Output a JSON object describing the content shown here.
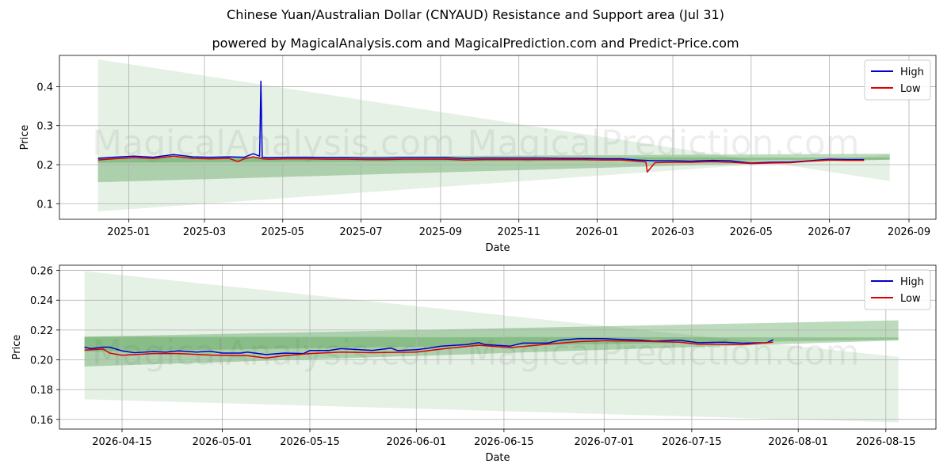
{
  "title": "Chinese Yuan/Australian Dollar (CNYAUD) Resistance and Support area (Jul 31)",
  "subtitle": "powered by MagicalAnalysis.com and MagicalPrediction.com and Predict-Price.com",
  "watermarks": [
    "MagicalAnalysis.com",
    "MagicalPrediction.com"
  ],
  "colors": {
    "high": "#0000cc",
    "low": "#dd0000",
    "band": "#2e8b2e",
    "grid": "#b0b0b0"
  },
  "chart_data": [
    {
      "type": "line",
      "xlabel": "Date",
      "ylabel": "Price",
      "x_ticks": [
        "2025-01",
        "2025-03",
        "2025-05",
        "2025-07",
        "2025-09",
        "2025-11",
        "2026-01",
        "2026-03",
        "2026-05",
        "2026-07",
        "2026-09"
      ],
      "y_ticks": [
        "0.1",
        "0.2",
        "0.3",
        "0.4"
      ],
      "xlim": [
        "2024-11-08",
        "2026-09-22"
      ],
      "ylim": [
        0.06,
        0.48
      ],
      "grid": true,
      "legend": "top-right",
      "legend_entries": [
        "High",
        "Low"
      ],
      "bands": [
        {
          "x": [
            "2024-12-08",
            "2026-08-17"
          ],
          "upper": [
            0.47,
            0.158
          ],
          "lower": [
            0.08,
            0.225
          ],
          "opacity": 0.12
        },
        {
          "x": [
            "2024-12-08",
            "2026-08-17"
          ],
          "upper": [
            0.218,
            0.228
          ],
          "lower": [
            0.155,
            0.213
          ],
          "opacity": 0.32
        },
        {
          "x": [
            "2024-12-08",
            "2026-08-17"
          ],
          "upper": [
            0.22,
            0.218
          ],
          "lower": [
            0.205,
            0.213
          ],
          "opacity": 0.28
        }
      ],
      "series": [
        {
          "name": "High",
          "x": [
            "2024-12-08",
            "2024-12-20",
            "2025-01-05",
            "2025-01-20",
            "2025-02-05",
            "2025-02-20",
            "2025-03-05",
            "2025-03-20",
            "2025-04-01",
            "2025-04-08",
            "2025-04-13",
            "2025-04-14",
            "2025-04-15",
            "2025-04-20",
            "2025-05-05",
            "2025-05-20",
            "2025-06-05",
            "2025-06-20",
            "2025-07-05",
            "2025-07-20",
            "2025-08-05",
            "2025-08-20",
            "2025-09-05",
            "2025-09-20",
            "2025-10-05",
            "2025-10-20",
            "2025-11-05",
            "2025-11-20",
            "2025-12-05",
            "2025-12-20",
            "2026-01-05",
            "2026-01-20",
            "2026-02-01",
            "2026-02-08",
            "2026-02-15",
            "2026-03-01",
            "2026-03-15",
            "2026-04-01",
            "2026-04-15",
            "2026-05-01",
            "2026-05-15",
            "2026-06-01",
            "2026-06-15",
            "2026-07-01",
            "2026-07-15",
            "2026-07-28"
          ],
          "y": [
            0.216,
            0.219,
            0.222,
            0.219,
            0.226,
            0.22,
            0.219,
            0.22,
            0.219,
            0.228,
            0.222,
            0.414,
            0.219,
            0.218,
            0.219,
            0.219,
            0.218,
            0.218,
            0.217,
            0.217,
            0.218,
            0.218,
            0.218,
            0.216,
            0.217,
            0.217,
            0.217,
            0.217,
            0.216,
            0.216,
            0.215,
            0.215,
            0.212,
            0.211,
            0.21,
            0.21,
            0.209,
            0.211,
            0.21,
            0.204,
            0.206,
            0.207,
            0.21,
            0.214,
            0.213,
            0.213
          ]
        },
        {
          "name": "Low",
          "x": [
            "2024-12-08",
            "2024-12-20",
            "2025-01-05",
            "2025-01-20",
            "2025-02-05",
            "2025-02-20",
            "2025-03-05",
            "2025-03-20",
            "2025-03-27",
            "2025-04-01",
            "2025-04-08",
            "2025-04-15",
            "2025-04-20",
            "2025-05-05",
            "2025-05-20",
            "2025-06-05",
            "2025-06-20",
            "2025-07-05",
            "2025-07-20",
            "2025-08-05",
            "2025-08-20",
            "2025-09-05",
            "2025-09-20",
            "2025-10-05",
            "2025-10-20",
            "2025-11-05",
            "2025-11-20",
            "2025-12-05",
            "2025-12-20",
            "2026-01-05",
            "2026-01-20",
            "2026-02-01",
            "2026-02-08",
            "2026-02-09",
            "2026-02-15",
            "2026-03-01",
            "2026-03-15",
            "2026-04-01",
            "2026-04-15",
            "2026-05-01",
            "2026-05-15",
            "2026-06-01",
            "2026-06-15",
            "2026-07-01",
            "2026-07-15",
            "2026-07-28"
          ],
          "y": [
            0.212,
            0.215,
            0.218,
            0.216,
            0.222,
            0.216,
            0.215,
            0.216,
            0.208,
            0.215,
            0.22,
            0.215,
            0.214,
            0.215,
            0.215,
            0.214,
            0.214,
            0.213,
            0.213,
            0.214,
            0.214,
            0.214,
            0.212,
            0.213,
            0.213,
            0.213,
            0.213,
            0.213,
            0.213,
            0.212,
            0.212,
            0.209,
            0.207,
            0.181,
            0.205,
            0.206,
            0.206,
            0.208,
            0.206,
            0.203,
            0.204,
            0.205,
            0.209,
            0.212,
            0.211,
            0.211
          ]
        }
      ]
    },
    {
      "type": "line",
      "xlabel": "Date",
      "ylabel": "Price",
      "x_ticks": [
        "2026-04-15",
        "2026-05-01",
        "2026-05-15",
        "2026-06-01",
        "2026-06-15",
        "2026-07-01",
        "2026-07-15",
        "2026-08-01",
        "2026-08-15"
      ],
      "y_ticks": [
        "0.16",
        "0.18",
        "0.20",
        "0.22",
        "0.24",
        "0.26"
      ],
      "xlim": [
        "2026-04-05",
        "2026-08-23"
      ],
      "ylim": [
        0.1535,
        0.2635
      ],
      "grid": true,
      "legend": "top-right",
      "legend_entries": [
        "High",
        "Low"
      ],
      "bands": [
        {
          "x": [
            "2026-04-09",
            "2026-08-17"
          ],
          "upper": [
            0.2595,
            0.202
          ],
          "lower": [
            0.1735,
            0.158
          ],
          "opacity": 0.12
        },
        {
          "x": [
            "2026-04-09",
            "2026-08-17"
          ],
          "upper": [
            0.2155,
            0.2265
          ],
          "lower": [
            0.1955,
            0.213
          ],
          "opacity": 0.32
        },
        {
          "x": [
            "2026-04-09",
            "2026-08-17"
          ],
          "upper": [
            0.2155,
            0.215
          ],
          "lower": [
            0.2055,
            0.2135
          ],
          "opacity": 0.28
        }
      ],
      "series": [
        {
          "name": "High",
          "x": [
            "2026-04-09",
            "2026-04-10",
            "2026-04-12",
            "2026-04-13",
            "2026-04-15",
            "2026-04-17",
            "2026-04-20",
            "2026-04-22",
            "2026-04-24",
            "2026-04-27",
            "2026-04-29",
            "2026-05-01",
            "2026-05-04",
            "2026-05-05",
            "2026-05-08",
            "2026-05-11",
            "2026-05-14",
            "2026-05-15",
            "2026-05-18",
            "2026-05-20",
            "2026-05-25",
            "2026-05-28",
            "2026-05-29",
            "2026-06-01",
            "2026-06-03",
            "2026-06-05",
            "2026-06-09",
            "2026-06-11",
            "2026-06-12",
            "2026-06-16",
            "2026-06-18",
            "2026-06-22",
            "2026-06-24",
            "2026-06-27",
            "2026-07-01",
            "2026-07-03",
            "2026-07-07",
            "2026-07-09",
            "2026-07-13",
            "2026-07-16",
            "2026-07-20",
            "2026-07-23",
            "2026-07-27",
            "2026-07-28"
          ],
          "y": [
            0.2085,
            0.2075,
            0.2085,
            0.2085,
            0.206,
            0.2048,
            0.2055,
            0.2052,
            0.206,
            0.2052,
            0.2058,
            0.2045,
            0.2045,
            0.2052,
            0.2035,
            0.2045,
            0.2042,
            0.2062,
            0.2062,
            0.2075,
            0.2063,
            0.2078,
            0.2062,
            0.2068,
            0.2078,
            0.2092,
            0.2102,
            0.2115,
            0.2102,
            0.2092,
            0.2112,
            0.2112,
            0.2132,
            0.2142,
            0.2142,
            0.2138,
            0.2132,
            0.2125,
            0.2132,
            0.2115,
            0.2118,
            0.2112,
            0.2115,
            0.2135
          ]
        },
        {
          "name": "Low",
          "x": [
            "2026-04-09",
            "2026-04-12",
            "2026-04-13",
            "2026-04-15",
            "2026-04-20",
            "2026-04-24",
            "2026-04-29",
            "2026-05-05",
            "2026-05-08",
            "2026-05-11",
            "2026-05-15",
            "2026-05-20",
            "2026-05-25",
            "2026-06-01",
            "2026-06-05",
            "2026-06-09",
            "2026-06-11",
            "2026-06-16",
            "2026-06-22",
            "2026-06-27",
            "2026-07-01",
            "2026-07-07",
            "2026-07-13",
            "2026-07-16",
            "2026-07-23",
            "2026-07-28"
          ],
          "y": [
            0.2065,
            0.2072,
            0.2045,
            0.203,
            0.2042,
            0.2042,
            0.2032,
            0.2028,
            0.2012,
            0.2028,
            0.2042,
            0.2052,
            0.2048,
            0.2052,
            0.2072,
            0.209,
            0.2098,
            0.2082,
            0.2105,
            0.2122,
            0.2128,
            0.2125,
            0.2118,
            0.2105,
            0.2102,
            0.2118
          ]
        }
      ]
    }
  ]
}
